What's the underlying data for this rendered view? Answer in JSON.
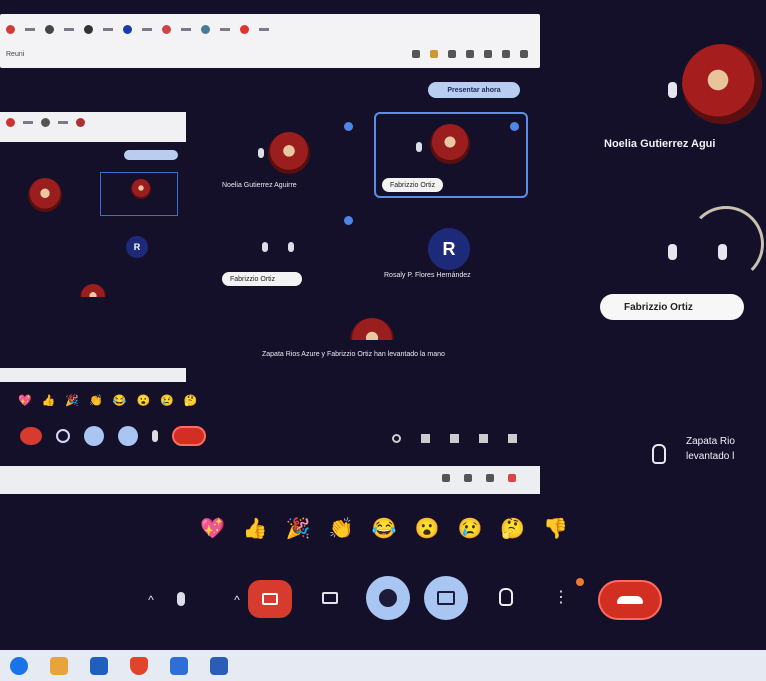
{
  "browser": {
    "address_fragment": "Reuni",
    "present_button": "Presentar ahora"
  },
  "participants": {
    "main": {
      "name": "Noelia Gutierrez Agui",
      "chip_name": "Fabrizzio Ortiz"
    },
    "grid": [
      {
        "name": "Noelia Gutierrez Aguirre"
      },
      {
        "name": "Fabrizzio Ortiz"
      },
      {
        "name": "Fabrizzio Ortiz"
      },
      {
        "name": "Rosaly P. Flores Hernández"
      }
    ],
    "initial_R": "R"
  },
  "notice": {
    "line1": "Zapata Rio",
    "line2": "levantado l",
    "inner_text": "Zapata Rios Azure y Fabrizzio Ortiz han levantado la mano"
  },
  "reactions": [
    "💖",
    "👍",
    "🎉",
    "👏",
    "😂",
    "😮",
    "😢",
    "🤔",
    "👎"
  ],
  "colors": {
    "background": "#15102a",
    "end_call": "#d22e22",
    "camera_off": "#d63b2e",
    "active_blue": "#a9c6f3",
    "avatar_red": "#9b1e1e"
  },
  "controls": {
    "mic": "mic-icon",
    "camera": "camera-off-icon",
    "captions": "captions-icon",
    "reactions": "emoji-icon",
    "present": "present-icon",
    "raise_hand": "hand-icon",
    "more": "more-vertical-icon",
    "end_call": "end-call-icon"
  }
}
